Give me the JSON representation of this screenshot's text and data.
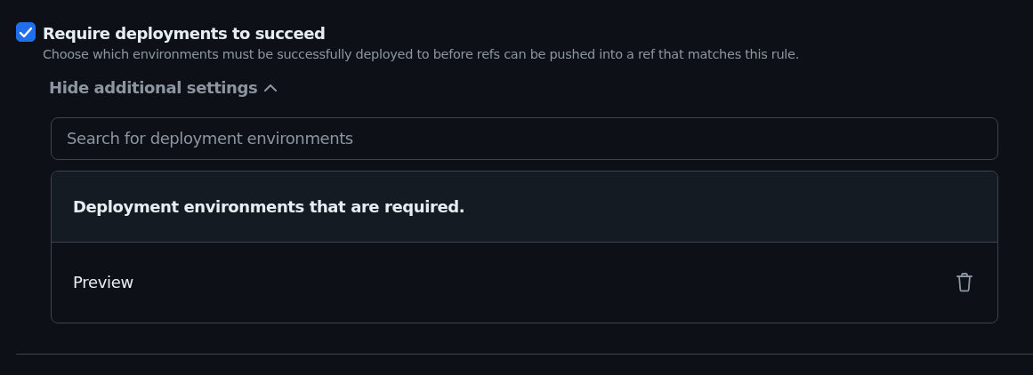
{
  "rule": {
    "label": "Require deployments to succeed",
    "checked": true,
    "description": "Choose which environments must be successfully deployed to before refs can be pushed into a ref that matches this rule."
  },
  "settings_toggle": {
    "label": "Hide additional settings",
    "expanded": true
  },
  "search": {
    "placeholder": "Search for deployment environments"
  },
  "environments": {
    "header": "Deployment environments that are required.",
    "items": [
      {
        "name": "Preview"
      }
    ]
  }
}
